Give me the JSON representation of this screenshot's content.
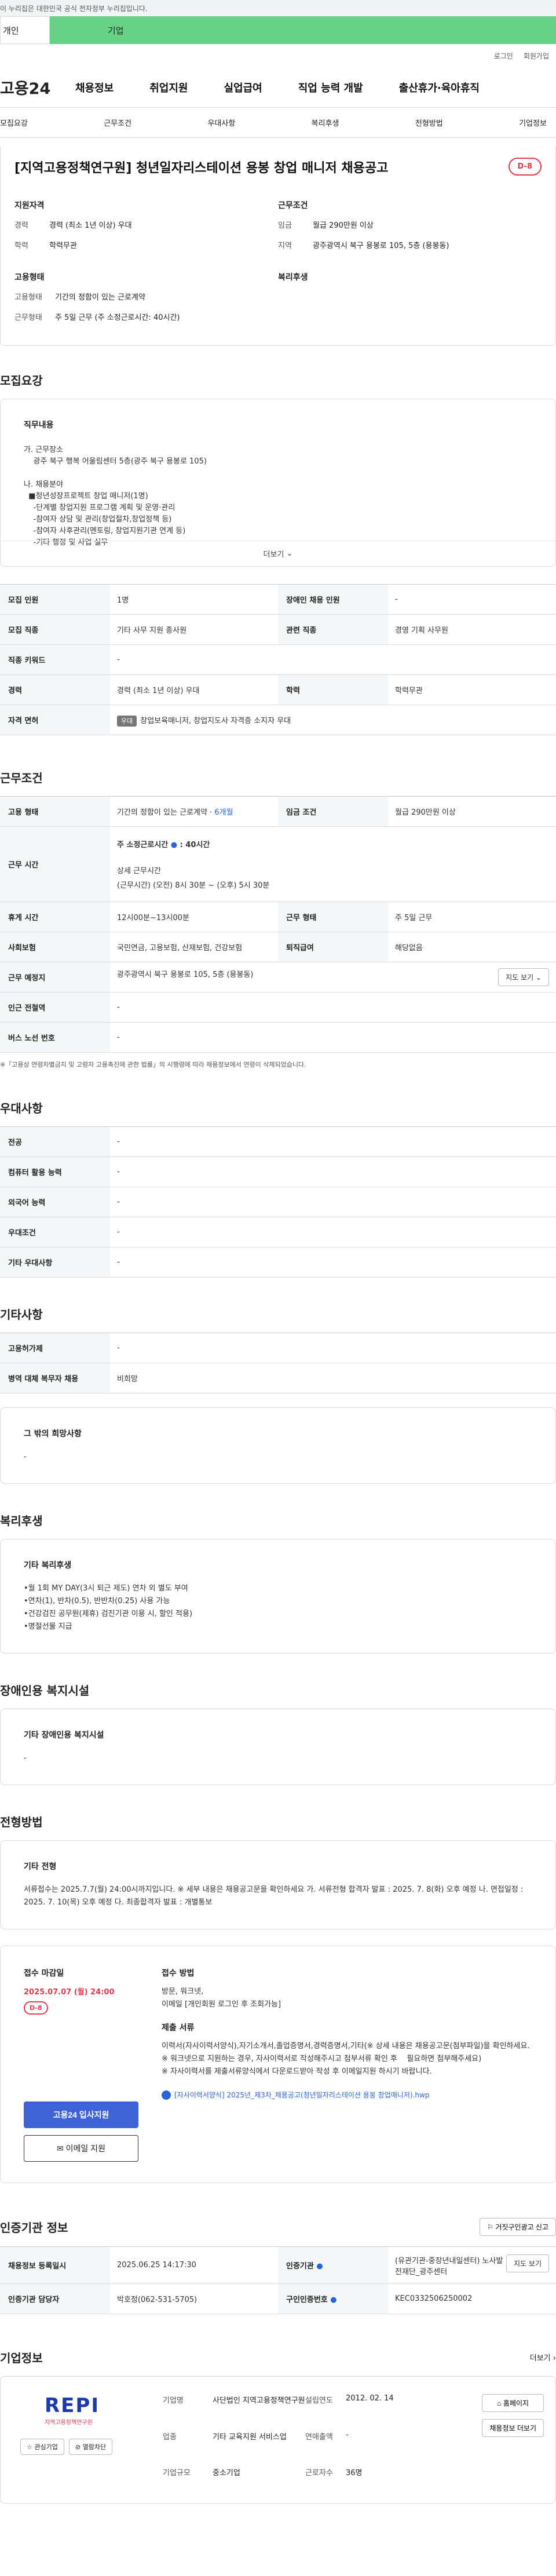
{
  "gov_bar": {
    "text": "이 누리집은 대한민국 공식 전자정부 누리집입니다."
  },
  "site_tabs": {
    "individual": "개인",
    "company": "기업"
  },
  "util": {
    "login": "로그인",
    "signup": "회원가입"
  },
  "logo": "고용24",
  "gnb": [
    "채용정보",
    "취업지원",
    "실업급여",
    "직업 능력 개발",
    "출산휴가·육아휴직"
  ],
  "subnav": [
    "모집요강",
    "근무조건",
    "우대사항",
    "복리후생",
    "전형방법",
    "기업정보"
  ],
  "title": "[지역고용정책연구원] 청년일자리스테이션 용봉 창업 매니저 채용공고",
  "dday": "D-8",
  "summary": {
    "qual_head": "지원자격",
    "career_k": "경력",
    "career_v": "경력 (최소 1년 이상) 우대",
    "edu_k": "학력",
    "edu_v": "학력무관",
    "cond_head": "근무조건",
    "wage_k": "임금",
    "wage_v": "월급 290만원 이상",
    "area_k": "지역",
    "area_v": "광주광역시 북구 용봉로 105, 5층 (용봉동)",
    "type_head": "고용형태",
    "emp_k": "고용형태",
    "emp_v": "기간의 정함이 있는 근로계약",
    "hours_k": "근무형태",
    "hours_v": "주 5일 근무 (주 소정근로시간: 40시간)",
    "welfare_head": "복리후생"
  },
  "recruit": {
    "section": "모집요강",
    "job_head": "직무내용",
    "job_body": "가. 근무장소\n    광주 북구 행복 어울림센터 5층(광주 북구 용봉로 105)\n\n나. 채용분야\n  ■청년성장프로젝트 창업 매니저(1명)\n    -단계별 창업지원 프로그램 계획 및 운영·관리\n    -참여자 상담 및 관리(창업절차,창업정책 등)\n    -참여자 사후관리(멘토링, 창업지원기관 연계 등)\n    -기타 행정 및 사업 실무",
    "more": "더보기"
  },
  "recruit_table": {
    "people_k": "모집 인원",
    "people_v": "1명",
    "disabled_k": "장애인 채용 인원",
    "disabled_v": "-",
    "job_k": "모집 직종",
    "job_v": "기타 사무 지원 종사원",
    "related_k": "관련 직종",
    "related_v": "경영 기획 사무원",
    "keyword_k": "직종 키워드",
    "keyword_v": "-",
    "career_k": "경력",
    "career_v": "경력 (최소 1년 이상) 우대",
    "edu_k": "학력",
    "edu_v": "학력무관",
    "license_k": "자격 면허",
    "license_badge": "우대",
    "license_v": "창업보육매니저, 창업지도사 자격증 소지자 우대"
  },
  "work": {
    "section": "근무조건",
    "emp_k": "고용 형태",
    "emp_v": "기간의 정함이 있는 근로계약 · ",
    "emp_months": "6개월",
    "wage_k": "임금 조건",
    "wage_v": "월급 290만원 이상",
    "time_k": "근무 시간",
    "time_total": "주 소정근로시간",
    "time_total_v": ": 40시간",
    "time_detail_h": "상세 근무시간",
    "time_detail_v": "(근무시간) (오전) 8시 30분 ~ (오후) 5시 30분",
    "rest_k": "휴게 시간",
    "rest_v": "12시00분~13시00분",
    "shift_k": "근무 형태",
    "shift_v": "주 5일 근무",
    "ins_k": "사회보험",
    "ins_v": "국민연금, 고용보험, 산재보험, 건강보험",
    "ret_k": "퇴직급여",
    "ret_v": "해당없음",
    "place_k": "근무 예정지",
    "place_v": "광주광역시 북구 용봉로 105, 5층 (용봉동)",
    "map": "지도 보기",
    "sub_k": "인근 전철역",
    "sub_v": "-",
    "bus_k": "버스 노선 번호",
    "bus_v": "-",
    "note": "※「고용상 연령차별금지 및 고령자 고용촉진에 관한 법률」의 시행령에 따라 채용정보에서 연령이 삭제되었습니다."
  },
  "pref": {
    "section": "우대사항",
    "major_k": "전공",
    "major_v": "-",
    "pc_k": "컴퓨터 활용 능력",
    "pc_v": "-",
    "lang_k": "외국어 능력",
    "lang_v": "-",
    "cond_k": "우대조건",
    "cond_v": "-",
    "etc_k": "기타 우대사항",
    "etc_v": "-"
  },
  "other": {
    "section": "기타사항",
    "disab_k": "고용허가제",
    "disab_v": "-",
    "mil_k": "병역 대체 복무자 채용",
    "mil_v": "비희망",
    "wish_h": "그 밖의 희망사항",
    "wish_v": "-"
  },
  "welfare": {
    "section": "복리후생",
    "h": "기타 복리후생",
    "body": "•월 1회 MY DAY(3시 퇴근 제도) 연차 외 별도 부여\n•연차(1), 반차(0.5), 반반차(0.25) 사용 가능\n•건강검진 공무원(제휴) 검진기관 이용 시, 할인 적용)\n•명절선물 지급"
  },
  "facility": {
    "section": "장애인용 복지시설",
    "h": "기타 장애인용 복지시설",
    "v": "-"
  },
  "selection": {
    "section": "전형방법",
    "h": "기타 전형",
    "body": "서류접수는 2025.7.7(월) 24:00시까지입니다. ※ 세부 내용은 채용공고문을 확인하세요 가. 서류전형 합격자 발표 : 2025. 7. 8(화) 오후 예정 나. 면접일정 : 2025. 7. 10(목) 오후 예정 다. 최종합격자 발표 : 개별통보"
  },
  "apply": {
    "deadline_h": "접수 마감일",
    "deadline_v": "2025.07.07 (월) 24:00",
    "dday": "D-8",
    "method_h": "접수 방법",
    "method_v": "방문, 워크넷,\n이메일 [개인회원 로그인 후 조회가능]",
    "docs_h": "제출 서류",
    "docs_v": "이력서(자사이력서양식),자기소개서,졸업증명서,경력증명서,기타(※ 상세 내용은 채용공고문(첨부파일)을 확인하세요.  ※ 워크넷으로 지원하는 경우, 자사이력서로 작성해주시고 첨부서류 확인 후    필요하면 첨부해주세요)\n※ 자사이력서를 제출서류양식에서 다운로드받아 작성 후 이메일지원 하시기 바랍니다.",
    "file": "[자사이력서양식] 2025년_제3차_채용공고(청년일자리스테이션 용봉 창업매니저).hwp",
    "btn_apply": "고용24 입사지원",
    "btn_email": "이메일 지원"
  },
  "agency": {
    "section": "인증기관 정보",
    "report": "거짓구인광고 신고",
    "reg_k": "채용정보 등록일시",
    "reg_v": "2025.06.25 14:17:30",
    "org_k": "인증기관",
    "org_v": "(유관기관-중장년내일센터) 노사발전재단_광주센터",
    "map": "지도 보기",
    "mgr_k": "인증기관 담당자",
    "mgr_v": "박호정(062-531-5705)",
    "no_k": "구인인증번호",
    "no_v": "KEC0332506250002"
  },
  "company": {
    "section": "기업정보",
    "more": "더보기",
    "logo_text": "REPI",
    "logo_sub": "지역고용정책연구원",
    "fav": "관심기업",
    "block": "열람차단",
    "name_k": "기업명",
    "name_v": "사단법인 지역고용정책연구원",
    "found_k": "설립연도",
    "found_v": "2012. 02. 14",
    "ind_k": "업종",
    "ind_v": "기타 교육지원 서비스업",
    "sales_k": "연매출액",
    "sales_v": "-",
    "emp_k": "근로자수",
    "emp_v": "36명",
    "size_k": "기업규모",
    "size_v": "중소기업",
    "home_btn": "홈페이지",
    "list_btn": "채용정보 더보기"
  }
}
